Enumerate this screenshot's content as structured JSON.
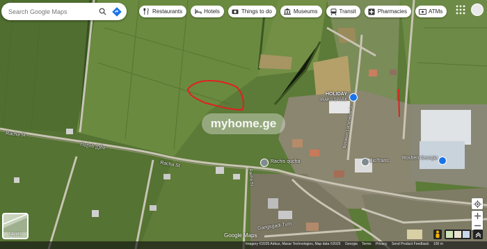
{
  "search": {
    "placeholder": "Search Google Maps"
  },
  "chips": [
    {
      "label": "Restaurants",
      "icon": "restaurant-icon"
    },
    {
      "label": "Hotels",
      "icon": "hotel-icon"
    },
    {
      "label": "Things to do",
      "icon": "camera-icon"
    },
    {
      "label": "Museums",
      "icon": "museum-icon"
    },
    {
      "label": "Transit",
      "icon": "transit-icon"
    },
    {
      "label": "Pharmacies",
      "icon": "pharmacy-icon"
    },
    {
      "label": "ATMs",
      "icon": "atm-icon"
    }
  ],
  "map_labels": {
    "racha_st_left": "Racha St",
    "georgian_left": "რაჭის ქუჩა",
    "racha_st_mid": "Racha St",
    "rachis_qucha": "Rachis qucha",
    "holiday_name": "HOLIDAY",
    "holiday_sub": "IRAKS SPARK",
    "bio_trans": "BioTrans",
    "roshen": "Roshen Georgia",
    "gangsgadi": "Gangsgadi Tum",
    "vertical_road": "Besarion Lominadze St",
    "small_road": "Racha St"
  },
  "watermark": "myhome.ge",
  "layers": {
    "label": "Layers"
  },
  "google_logo": "Google Maps",
  "attribution": {
    "imagery": "Imagery ©2025 Airbus, Maxar Technologies, Map data ©2025",
    "links": [
      "Georgia",
      "Terms",
      "Privacy",
      "Send Product Feedback",
      "100 m"
    ]
  },
  "colors": {
    "outline": "#e02020",
    "pin_blue": "#1a73e8",
    "chip_bg": "#ffffff"
  }
}
